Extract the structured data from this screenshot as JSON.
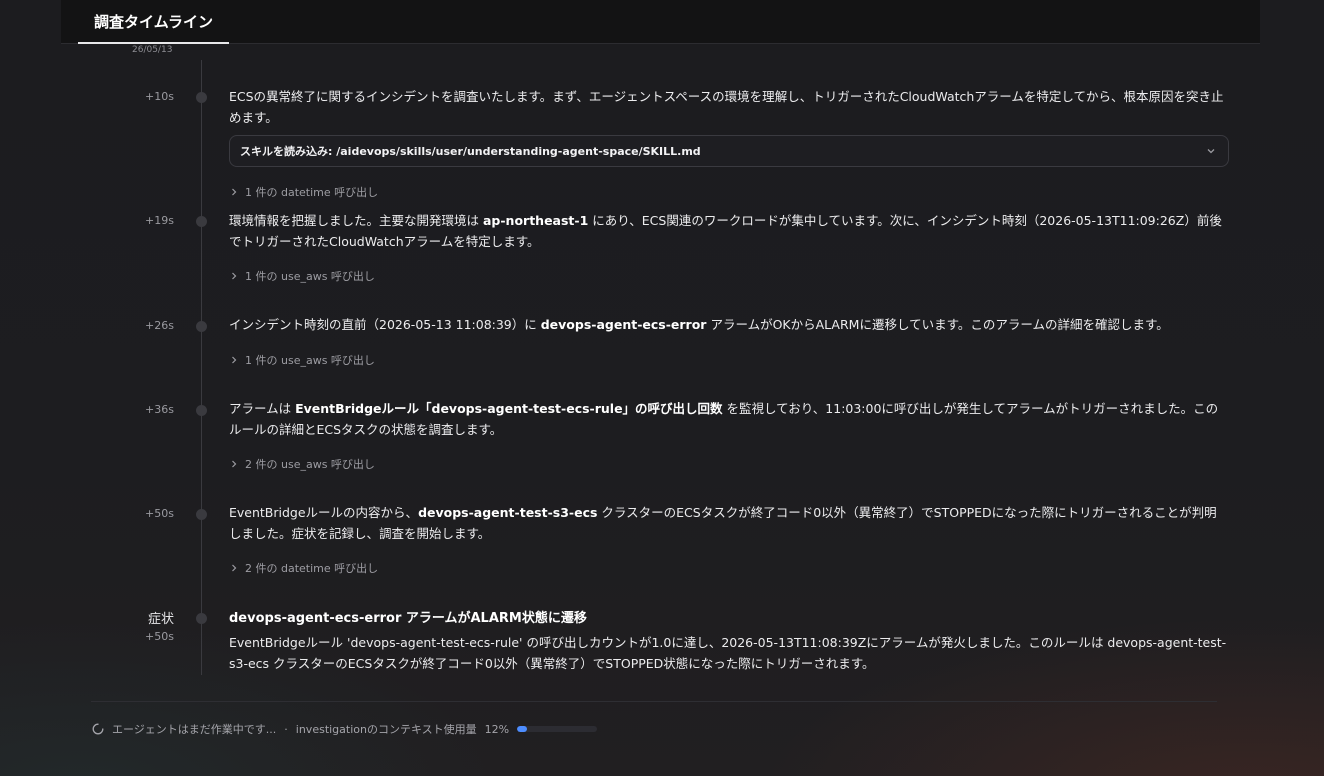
{
  "header": {
    "tab_label": "調査タイムライン"
  },
  "timeline": {
    "top_date": "26/05/13",
    "entries": [
      {
        "time": "+10s",
        "text_html": "ECSの異常終了に関するインシデントを調査いたします。まず、エージェントスペースの環境を理解し、トリガーされたCloudWatchアラームを特定してから、根本原因を突き止めます。",
        "skill": "スキルを読み込み: /aidevops/skills/user/understanding-agent-space/SKILL.md",
        "calls": "1 件の datetime 呼び出し"
      },
      {
        "time": "+19s",
        "text_pre": "環境情報を把握しました。主要な開発環境は ",
        "text_bold": "ap-northeast-1",
        "text_post": " にあり、ECS関連のワークロードが集中しています。次に、インシデント時刻（2026-05-13T11:09:26Z）前後でトリガーされたCloudWatchアラームを特定します。",
        "calls": "1 件の use_aws 呼び出し"
      },
      {
        "time": "+26s",
        "text_pre": "インシデント時刻の直前（2026-05-13 11:08:39）に ",
        "text_bold": "devops-agent-ecs-error",
        "text_post": " アラームがOKからALARMに遷移しています。このアラームの詳細を確認します。",
        "calls": "1 件の use_aws 呼び出し"
      },
      {
        "time": "+36s",
        "text_pre": "アラームは ",
        "text_bold": "EventBridgeルール「devops-agent-test-ecs-rule」の呼び出し回数",
        "text_post": " を監視しており、11:03:00に呼び出しが発生してアラームがトリガーされました。このルールの詳細とECSタスクの状態を調査します。",
        "calls": "2 件の use_aws 呼び出し"
      },
      {
        "time": "+50s",
        "text_pre": "EventBridgeルールの内容から、",
        "text_bold": "devops-agent-test-s3-ecs",
        "text_post": " クラスターのECSタスクが終了コード0以外（異常終了）でSTOPPEDになった際にトリガーされることが判明しました。症状を記録し、調査を開始します。",
        "calls": "2 件の datetime 呼び出し"
      }
    ],
    "symptom": {
      "label": "症状",
      "time": "+50s",
      "title": "devops-agent-ecs-error アラームがALARM状態に遷移",
      "text": "EventBridgeルール 'devops-agent-test-ecs-rule' の呼び出しカウントが1.0に達し、2026-05-13T11:08:39Zにアラームが発火しました。このルールは devops-agent-test-s3-ecs クラスターのECSタスクが終了コード0以外（異常終了）でSTOPPED状態になった際にトリガーされます。"
    }
  },
  "footer": {
    "status_text": "エージェントはまだ作業中です...",
    "separator": "·",
    "context_label": "investigationのコンテキスト使用量",
    "context_percent_text": "12%",
    "context_fraction": 0.12
  },
  "colors": {
    "accent": "#4d8dff"
  }
}
